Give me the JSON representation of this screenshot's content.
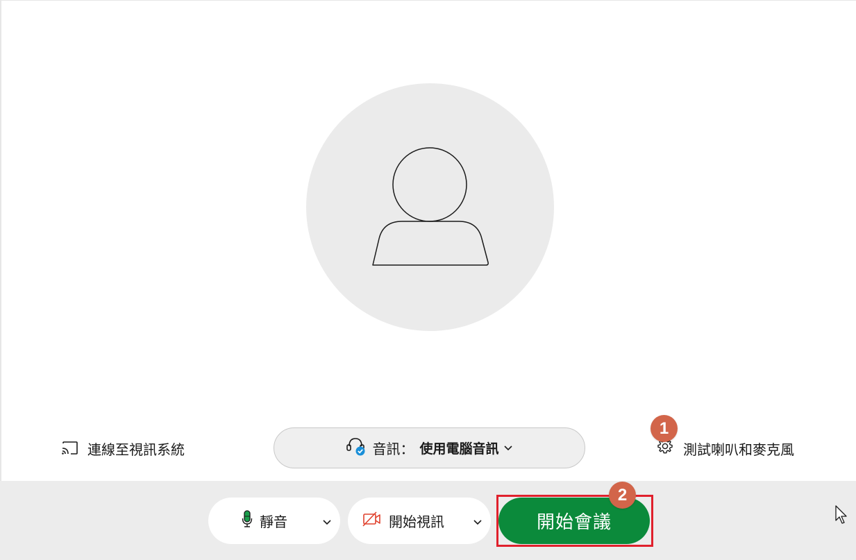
{
  "preview": {
    "connect_video_label": "連線至視訊系統",
    "audio_label": "音訊：",
    "audio_value": "使用電腦音訊",
    "test_speaker_label": "測試喇叭和麥克風"
  },
  "controls": {
    "mute_label": "靜音",
    "start_video_label": "開始視訊",
    "start_meeting_label": "開始會議"
  },
  "annotations": {
    "badge_1": "1",
    "badge_2": "2"
  },
  "colors": {
    "start_button": "#0b8a3b",
    "annotation_badge": "#d2654a",
    "highlight_outline": "#e0202c",
    "mic_active": "#1a9e4b",
    "video_off": "#e0402c",
    "audio_check": "#1a8fd8"
  },
  "icons": {
    "connect": "cast-icon",
    "audio": "headset-check-icon",
    "test": "gear-icon",
    "mute": "microphone-icon",
    "video": "video-off-icon"
  }
}
